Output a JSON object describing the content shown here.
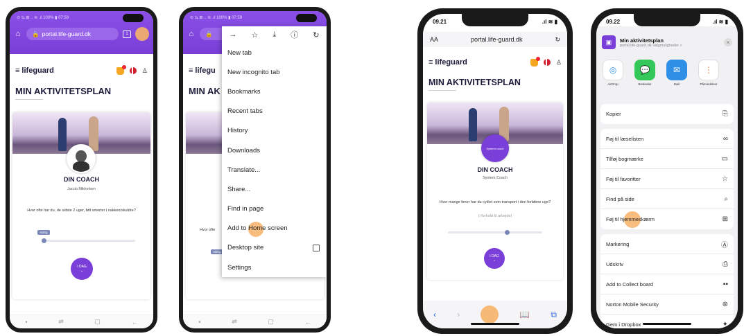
{
  "android_status": "⊙ ⇆ ⊞ ..   ≋ .ıl 100% ▮ 07:59",
  "android_url": "portal.life-guard.dk",
  "tabs_count": "1",
  "app": {
    "brand": "lifeguard",
    "page_title": "MIN AKTIVITETSPLAN",
    "coach_heading": "DIN COACH",
    "coach_name": "Jacob Mikkelsen",
    "question": "Hvor ofte har du, de sidste 2 uger, følt smerter i nakken/skuldre?",
    "chip_label": "Aldrig",
    "fab_label": "I DAG",
    "fab_chevron": "⌄"
  },
  "chrome_menu": {
    "toolbar_icons": [
      "forward-icon",
      "star-icon",
      "download-icon",
      "info-icon",
      "reload-icon"
    ],
    "items": [
      "New tab",
      "New incognito tab",
      "Bookmarks",
      "Recent tabs",
      "History",
      "Downloads",
      "Translate...",
      "Share...",
      "Find in page",
      "Add to Home screen",
      "Desktop site",
      "Settings"
    ],
    "partial_left_text": "Hvor ofte",
    "partial_title": "MIN AK",
    "partial_brand": "lifegu"
  },
  "ios_left": {
    "time": "09.21",
    "aa": "AA",
    "url": "portal.life-guard.dk",
    "coach_badge": "System coach",
    "coach_heading": "DIN COACH",
    "coach_name": "System Coach",
    "question": "Hvor mange timer har du cyklet som transport i den forløbne uge?",
    "hint": "(i forhold til arbejde)",
    "fab_label": "I DAG"
  },
  "ios_right": {
    "time": "09.22",
    "share_title": "Min aktivitetsplan",
    "share_sub": "portal.life-guard.dk  Valgmuligheder >",
    "apps": [
      "AirDrop",
      "Beskeder",
      "Mail",
      "Påmindelser"
    ],
    "group1": [
      "Kopier"
    ],
    "group2": [
      "Føj til læselisten",
      "Tilføj bogmærke",
      "Føj til favoritter",
      "Find på side",
      "Føj til hjemmeskærm"
    ],
    "group3": [
      "Markering",
      "Udskriv",
      "Add to Collect board",
      "Norton Mobile Security",
      "Gem i Dropbox"
    ]
  },
  "colors": {
    "purple": "#7a3fd8",
    "touch": "#f7b267",
    "ios_blue": "#2f6be3"
  }
}
